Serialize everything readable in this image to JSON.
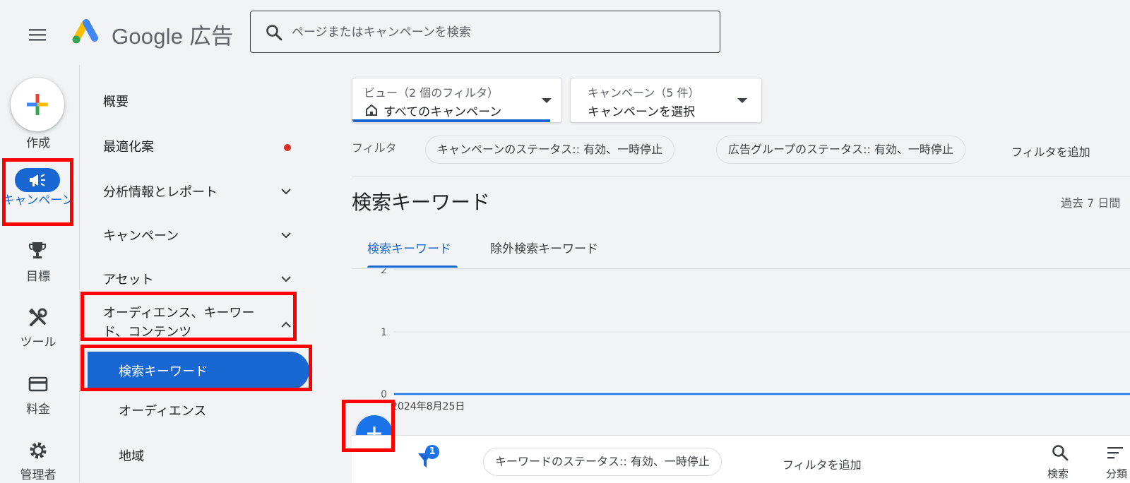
{
  "header": {
    "logo_text": "Google 広告",
    "search_placeholder": "ページまたはキャンペーンを検索"
  },
  "rail": {
    "create_label": "作成",
    "campaign_label": "キャンペーン",
    "goals_label": "目標",
    "tools_label": "ツール",
    "billing_label": "料金",
    "admin_label": "管理者"
  },
  "sidebar": {
    "overview": "概要",
    "recommendations": "最適化案",
    "insights_reports": "分析情報とレポート",
    "campaigns": "キャンペーン",
    "assets": "アセット",
    "audience_keywords_content": "オーディエンス、キーワード、コンテンツ",
    "sub_items": [
      "検索キーワード",
      "オーディエンス",
      "地域"
    ]
  },
  "filters": {
    "view_label": "ビュー（2 個のフィルタ）",
    "view_value": "すべてのキャンペーン",
    "campaign_label": "キャンペーン（5 件）",
    "campaign_value": "キャンペーンを選択",
    "filter_label": "フィルタ",
    "chips": [
      "キャンペーンのステータス:: 有効、一時停止",
      "広告グループのステータス:: 有効、一時停止"
    ],
    "add_filter": "フィルタを追加"
  },
  "main": {
    "title": "検索キーワード",
    "date_range": "過去 7 日間",
    "tabs": [
      "検索キーワード",
      "除外検索キーワード"
    ]
  },
  "chart_data": {
    "type": "line",
    "x": [
      "2024年8月25日"
    ],
    "y_ticks": [
      "2",
      "1",
      "0"
    ],
    "ylim": [
      0,
      2
    ],
    "series": [
      {
        "values": [
          0
        ]
      }
    ],
    "color": "#1a73e8"
  },
  "bottom_bar": {
    "filter_count": "1",
    "chip": "キーワードのステータス:: 有効、一時停止",
    "add_filter": "フィルタを追加",
    "search_label": "検索",
    "segment_label": "分類"
  },
  "colors": {
    "accent": "#1967d2",
    "highlight_box": "#ff0000",
    "notification_dot": "#d93025"
  }
}
